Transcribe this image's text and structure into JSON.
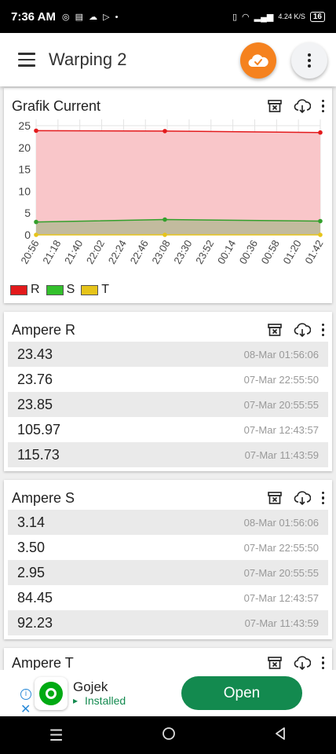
{
  "status_bar": {
    "time": "7:36 AM",
    "network": "4.24 K/S",
    "battery": "16"
  },
  "app_bar": {
    "title": "Warping 2"
  },
  "chart_card": {
    "title": "Grafik Current"
  },
  "chart_data": {
    "type": "area",
    "x": [
      "20:56",
      "21:18",
      "21:40",
      "22:02",
      "22:24",
      "22:46",
      "23:08",
      "23:30",
      "23:52",
      "00:14",
      "00:36",
      "00:58",
      "01:20",
      "01:42"
    ],
    "yticks": [
      0,
      5,
      10,
      15,
      20,
      25
    ],
    "ylim": [
      0,
      25
    ],
    "series": [
      {
        "name": "R",
        "color": "#e31a1c",
        "fill": "#f9c6c9",
        "points": [
          [
            0,
            23.85
          ],
          [
            0.453,
            23.76
          ],
          [
            1,
            23.43
          ]
        ]
      },
      {
        "name": "S",
        "color": "#33a02c",
        "fill": "#b8b896",
        "points": [
          [
            0,
            2.95
          ],
          [
            0.453,
            3.5
          ],
          [
            1,
            3.14
          ]
        ]
      },
      {
        "name": "T",
        "color": "#e6c41a",
        "fill": "#f4e9a8",
        "points": [
          [
            0,
            0
          ],
          [
            0.453,
            0
          ],
          [
            1,
            0
          ]
        ]
      }
    ],
    "legend": "bottom-left",
    "grid": true
  },
  "ampere_r": {
    "title": "Ampere R",
    "rows": [
      {
        "value": "23.43",
        "time": "08-Mar 01:56:06"
      },
      {
        "value": "23.76",
        "time": "07-Mar 22:55:50"
      },
      {
        "value": "23.85",
        "time": "07-Mar 20:55:55"
      },
      {
        "value": "105.97",
        "time": "07-Mar 12:43:57"
      },
      {
        "value": "115.73",
        "time": "07-Mar 11:43:59"
      }
    ]
  },
  "ampere_s": {
    "title": "Ampere S",
    "rows": [
      {
        "value": "3.14",
        "time": "08-Mar 01:56:06"
      },
      {
        "value": "3.50",
        "time": "07-Mar 22:55:50"
      },
      {
        "value": "2.95",
        "time": "07-Mar 20:55:55"
      },
      {
        "value": "84.45",
        "time": "07-Mar 12:43:57"
      },
      {
        "value": "92.23",
        "time": "07-Mar 11:43:59"
      }
    ]
  },
  "ampere_t": {
    "title": "Ampere T"
  },
  "ad": {
    "app_name": "Gojek",
    "status": "Installed",
    "button": "Open",
    "button_color": "#138a4f"
  }
}
